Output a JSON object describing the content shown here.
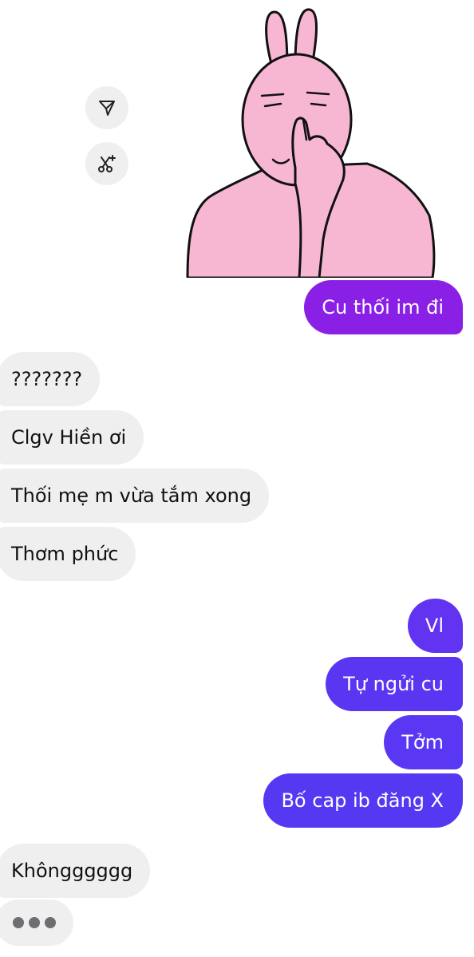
{
  "actions": {
    "share_icon": "send-icon",
    "remix_icon": "scissors-sparkle-icon"
  },
  "sticker": {
    "description_icon": "pink-bunny-sticker"
  },
  "messages": [
    {
      "text": "Cu thối im đi",
      "side": "out",
      "color": "#8a1fe6"
    },
    {
      "text": "???????",
      "side": "in"
    },
    {
      "text": "Clgv Hiền ơi",
      "side": "in"
    },
    {
      "text": "Thối mẹ m vừa tắm xong",
      "side": "in"
    },
    {
      "text": "Thơm phức",
      "side": "in"
    },
    {
      "text": "Vl",
      "side": "out",
      "color": "#6233f0"
    },
    {
      "text": "Tự ngửi cu",
      "side": "out",
      "color": "#5a36f2"
    },
    {
      "text": "Tởm",
      "side": "out",
      "color": "#5a37f3"
    },
    {
      "text": "Bố cap ib đăng X",
      "side": "out",
      "color": "#5538f2"
    },
    {
      "text": "Khôngggggg",
      "side": "in"
    }
  ],
  "colors": {
    "incoming_bg": "#efefef",
    "outgoing_purple": "#8a1fe6",
    "outgoing_indigo": "#5a36f2"
  }
}
